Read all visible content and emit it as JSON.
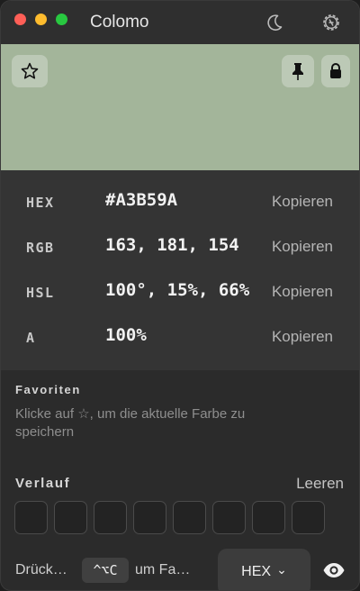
{
  "window": {
    "title": "Colomo",
    "controls": [
      "close",
      "minimize",
      "maximize"
    ],
    "icons": {
      "theme": "moon-icon",
      "settings": "gear-icon"
    }
  },
  "preview": {
    "color": "#A3B59A",
    "icons": [
      "star-icon",
      "pin-icon",
      "lock-icon"
    ]
  },
  "values": [
    {
      "key": "HEX",
      "value": "#A3B59A",
      "copy": "Kopieren"
    },
    {
      "key": "RGB",
      "value": "163, 181, 154",
      "copy": "Kopieren"
    },
    {
      "key": "HSL",
      "value": "100°, 15%, 66%",
      "copy": "Kopieren"
    },
    {
      "key": "A",
      "value": "100%",
      "copy": "Kopieren"
    }
  ],
  "favorites": {
    "title": "Favoriten",
    "hint": "Klicke auf ☆, um die aktuelle Farbe zu speichern"
  },
  "history": {
    "title": "Verlauf",
    "clear": "Leeren",
    "swatches": [
      "",
      "",
      "",
      "",
      "",
      "",
      "",
      ""
    ]
  },
  "footer": {
    "hint_prefix": "Drück…",
    "shortcut": "^⌥C",
    "hint_suffix": "um Fa…",
    "format": "HEX",
    "format_chevron": "⌄",
    "eye_icon": "eye-icon"
  }
}
